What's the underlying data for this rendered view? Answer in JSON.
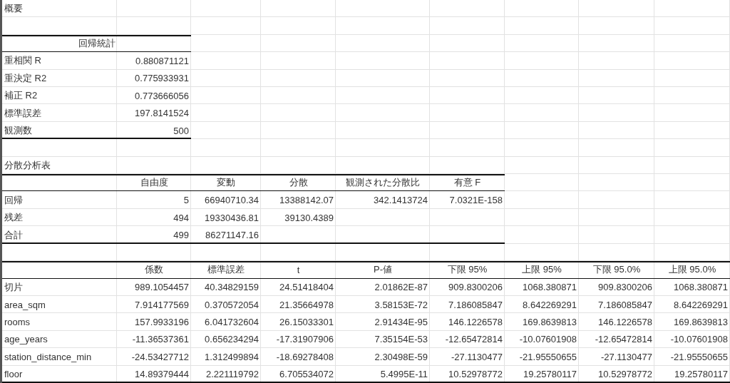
{
  "summary_title": "概要",
  "regression_stats": {
    "title": "回帰統計",
    "rows": [
      {
        "label": "重相関 R",
        "value": "0.880871121"
      },
      {
        "label": "重決定 R2",
        "value": "0.775933931"
      },
      {
        "label": "補正 R2",
        "value": "0.773666056"
      },
      {
        "label": "標準誤差",
        "value": "197.8141524"
      },
      {
        "label": "観測数",
        "value": "500"
      }
    ]
  },
  "anova": {
    "title": "分散分析表",
    "columns": [
      "自由度",
      "変動",
      "分散",
      "観測された分散比",
      "有意 F"
    ],
    "rows": [
      {
        "label": "回帰",
        "cells": [
          "5",
          "66940710.34",
          "13388142.07",
          "342.1413724",
          "7.0321E-158"
        ]
      },
      {
        "label": "残差",
        "cells": [
          "494",
          "19330436.81",
          "39130.4389"
        ]
      },
      {
        "label": "合計",
        "cells": [
          "499",
          "86271147.16"
        ]
      }
    ]
  },
  "coefficients": {
    "columns": [
      "係数",
      "標準誤差",
      "t",
      "P-値",
      "下限 95%",
      "上限 95%",
      "下限 95.0%",
      "上限 95.0%"
    ],
    "rows": [
      {
        "label": "切片",
        "cells": [
          "989.1054457",
          "40.34829159",
          "24.51418404",
          "2.01862E-87",
          "909.8300206",
          "1068.380871",
          "909.8300206",
          "1068.380871"
        ]
      },
      {
        "label": "area_sqm",
        "cells": [
          "7.914177569",
          "0.370572054",
          "21.35664978",
          "3.58153E-72",
          "7.186085847",
          "8.642269291",
          "7.186085847",
          "8.642269291"
        ]
      },
      {
        "label": "rooms",
        "cells": [
          "157.9933196",
          "6.041732604",
          "26.15033301",
          "2.91434E-95",
          "146.1226578",
          "169.8639813",
          "146.1226578",
          "169.8639813"
        ]
      },
      {
        "label": "age_years",
        "cells": [
          "-11.36537361",
          "0.656234294",
          "-17.31907906",
          "7.35154E-53",
          "-12.65472814",
          "-10.07601908",
          "-12.65472814",
          "-10.07601908"
        ]
      },
      {
        "label": "station_distance_min",
        "cells": [
          "-24.53427712",
          "1.312499894",
          "-18.69278408",
          "2.30498E-59",
          "-27.1130477",
          "-21.95550655",
          "-27.1130477",
          "-21.95550655"
        ]
      },
      {
        "label": "floor",
        "cells": [
          "14.89379444",
          "2.221119792",
          "6.705534072",
          "5.4995E-11",
          "10.52978772",
          "19.25780117",
          "10.52978772",
          "19.25780117"
        ]
      }
    ]
  }
}
